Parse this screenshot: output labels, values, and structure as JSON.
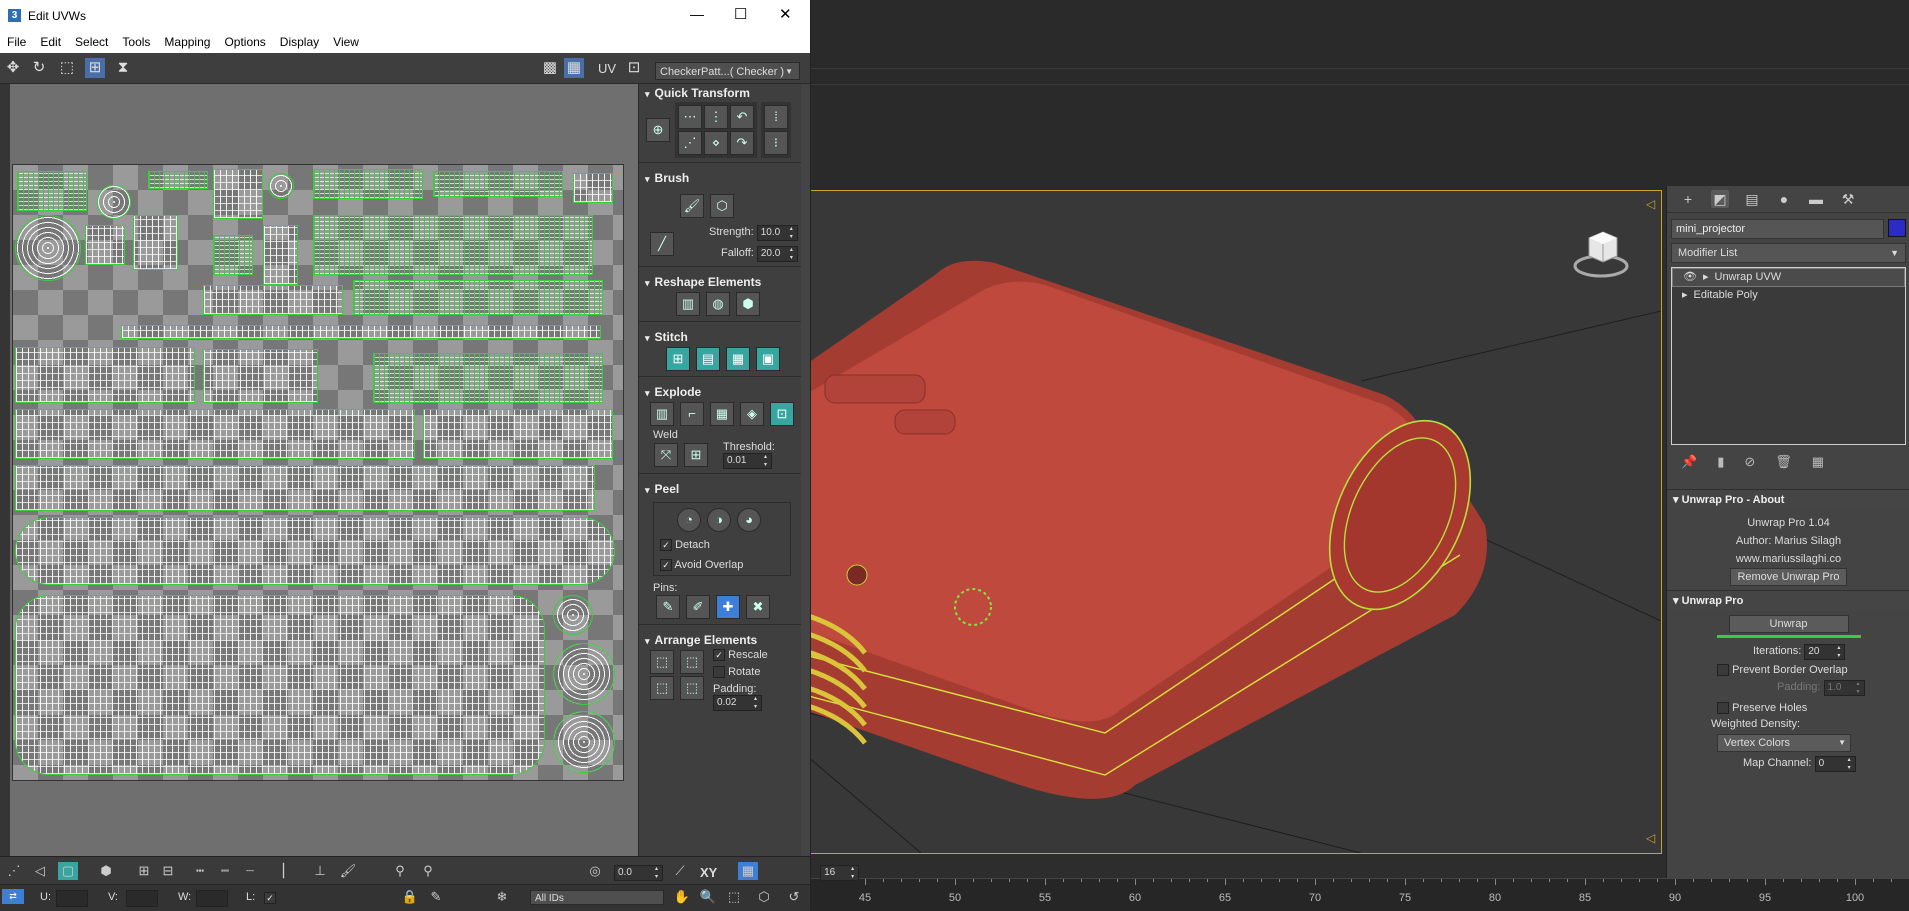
{
  "window": {
    "title": "Edit UVWs",
    "icon": "3",
    "controls": {
      "minimize": "—",
      "maximize": "☐",
      "close": "✕"
    }
  },
  "menu": [
    "File",
    "Edit",
    "Select",
    "Tools",
    "Mapping",
    "Options",
    "Display",
    "View"
  ],
  "uv_toolbar": {
    "uv_label": "UV",
    "checker_dropdown": "CheckerPatt...( Checker )"
  },
  "rollouts": {
    "quick_transform": "Quick Transform",
    "brush": {
      "title": "Brush",
      "strength_label": "Strength:",
      "strength": "10.0",
      "falloff_label": "Falloff:",
      "falloff": "20.0"
    },
    "reshape": "Reshape Elements",
    "stitch": "Stitch",
    "explode": {
      "title": "Explode",
      "weld": "Weld",
      "threshold_label": "Threshold:",
      "threshold": "0.01"
    },
    "peel": {
      "title": "Peel",
      "detach": "Detach",
      "avoid_overlap": "Avoid Overlap",
      "pins": "Pins:"
    },
    "arrange": {
      "title": "Arrange Elements",
      "rescale": "Rescale",
      "rotate": "Rotate",
      "padding_label": "Padding:",
      "padding": "0.02"
    }
  },
  "bottom_bar": {
    "spin_value": "0.0",
    "xy": "XY",
    "grid_value": "16",
    "u_label": "U:",
    "v_label": "V:",
    "w_label": "W:",
    "l_label": "L:",
    "ids_dropdown": "All IDs"
  },
  "command_panel": {
    "object_name": "mini_projector",
    "object_color": "#2c2cc4",
    "modifier_list": "Modifier List",
    "stack": [
      {
        "label": "Unwrap UVW",
        "selected": true
      },
      {
        "label": "Editable Poly",
        "selected": false
      }
    ],
    "about": {
      "title": "Unwrap Pro - About",
      "version": "Unwrap Pro 1.04",
      "author": "Author: Marius Silagh",
      "url": "www.mariussilaghi.co",
      "remove_button": "Remove Unwrap Pro"
    },
    "unwrap_pro": {
      "title": "Unwrap Pro",
      "unwrap_button": "Unwrap",
      "iterations_label": "Iterations:",
      "iterations": "20",
      "prevent_border_overlap": "Prevent Border Overlap",
      "padding_label": "Padding:",
      "padding": "1.0",
      "preserve_holes": "Preserve Holes",
      "weighted_density": "Weighted Density:",
      "density_mode": "Vertex Colors",
      "map_channel_label": "Map Channel:",
      "map_channel": "0"
    }
  },
  "timeline": {
    "ticks": [
      "45",
      "50",
      "55",
      "60",
      "65",
      "70",
      "75",
      "80",
      "85",
      "90",
      "95",
      "100"
    ]
  },
  "colors": {
    "accent_green": "#36d13a",
    "projector_red": "#b3443a",
    "viewport_border": "#c8a42a"
  }
}
